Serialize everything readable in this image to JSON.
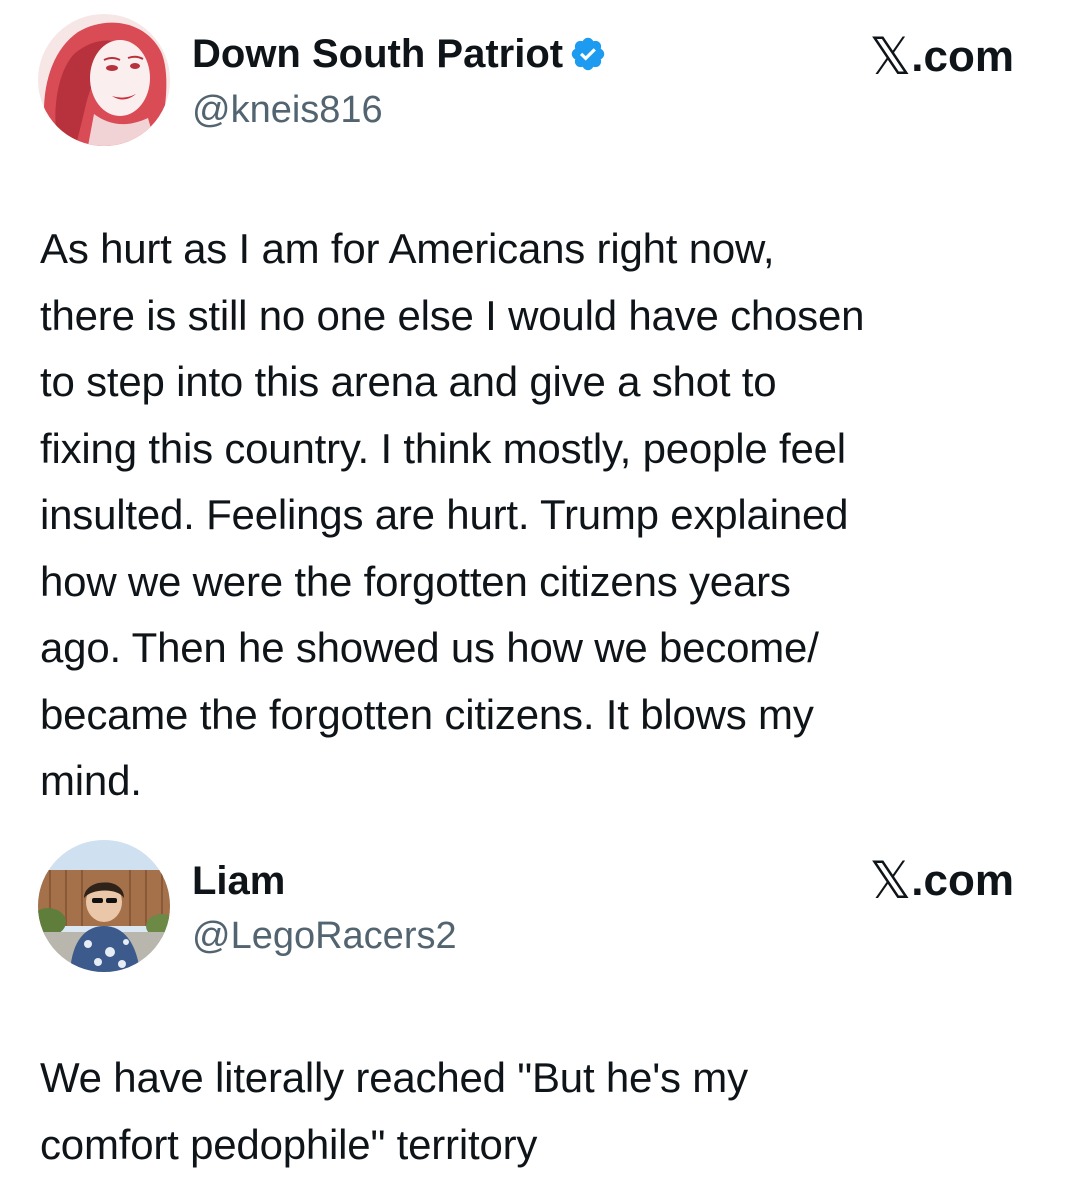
{
  "posts": [
    {
      "display_name": "Down South Patriot",
      "verified": true,
      "handle": "@kneis816",
      "source": ".com",
      "source_glyph": "𝕏",
      "avatar_icon": "woman-portrait-red-tint-avatar",
      "text_lines": [
        "As hurt as I am for Americans right now,",
        "there is still no one else I would have chosen",
        "to step into this arena and give a shot to",
        "fixing this country.  I think mostly, people feel",
        "insulted.  Feelings are hurt.  Trump explained",
        "how we were the forgotten citizens years",
        "ago.  Then he showed us how we become/",
        "became the forgotten citizens. It blows my",
        "mind."
      ]
    },
    {
      "display_name": "Liam",
      "verified": false,
      "handle": "@LegoRacers2",
      "source": ".com",
      "source_glyph": "𝕏",
      "avatar_icon": "person-outdoor-photo-avatar",
      "text_lines": [
        "We have literally reached \"But he's my",
        "comfort pedophile\" territory"
      ]
    }
  ],
  "colors": {
    "text": "#0f1419",
    "handle": "#536471",
    "verified": "#1d9bf0",
    "background": "#ffffff"
  }
}
